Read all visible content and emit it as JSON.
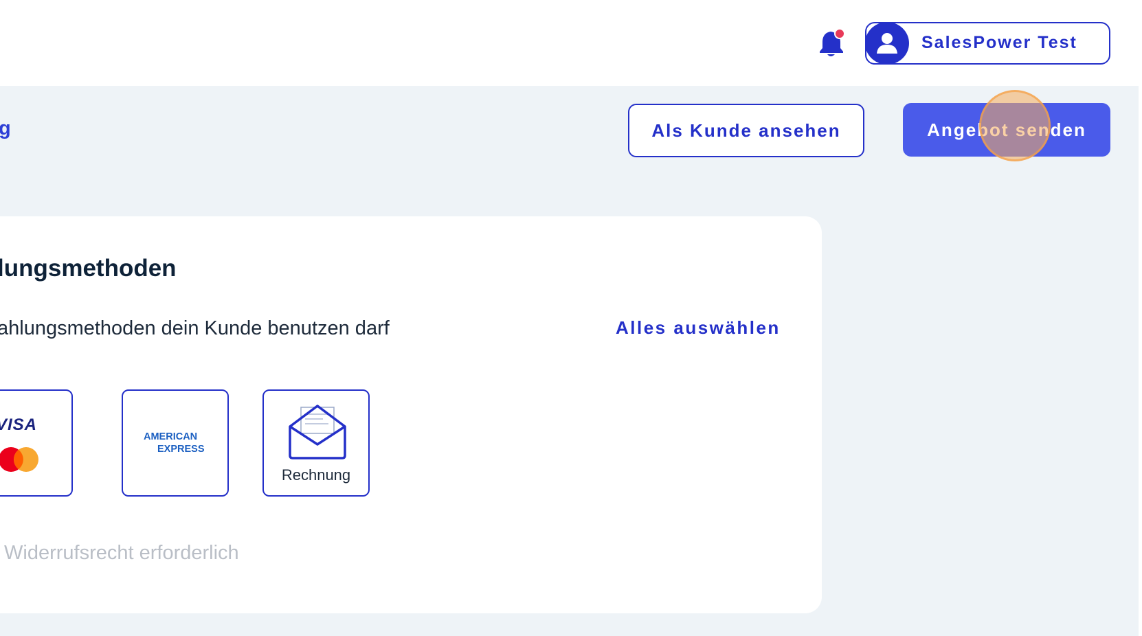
{
  "header": {
    "user_name": "SalesPower Test"
  },
  "toolbar": {
    "page_title": "g",
    "view_as_customer_label": "Als Kunde ansehen",
    "send_offer_label": "Angebot senden"
  },
  "payment_card": {
    "title": "lungsmethoden",
    "subtitle": "ahlungsmethoden dein Kunde benutzen darf",
    "select_all_label": "Alles auswählen",
    "methods": [
      {
        "name": "visa-mastercard",
        "label": "VISA"
      },
      {
        "name": "american-express",
        "label_line1": "AMERICAN",
        "label_line2": "EXPRESS"
      },
      {
        "name": "invoice",
        "label": "Rechnung"
      }
    ],
    "withdrawal_note": "Widerrufsrecht erforderlich"
  },
  "colors": {
    "brand_blue": "#2430c9",
    "primary_button": "#4a5bea",
    "content_bg": "#eef3f7",
    "notification_dot": "#e83a59"
  },
  "icons": [
    "bell-icon",
    "notification-dot",
    "user-avatar-icon",
    "envelope-icon",
    "mastercard-logo"
  ]
}
